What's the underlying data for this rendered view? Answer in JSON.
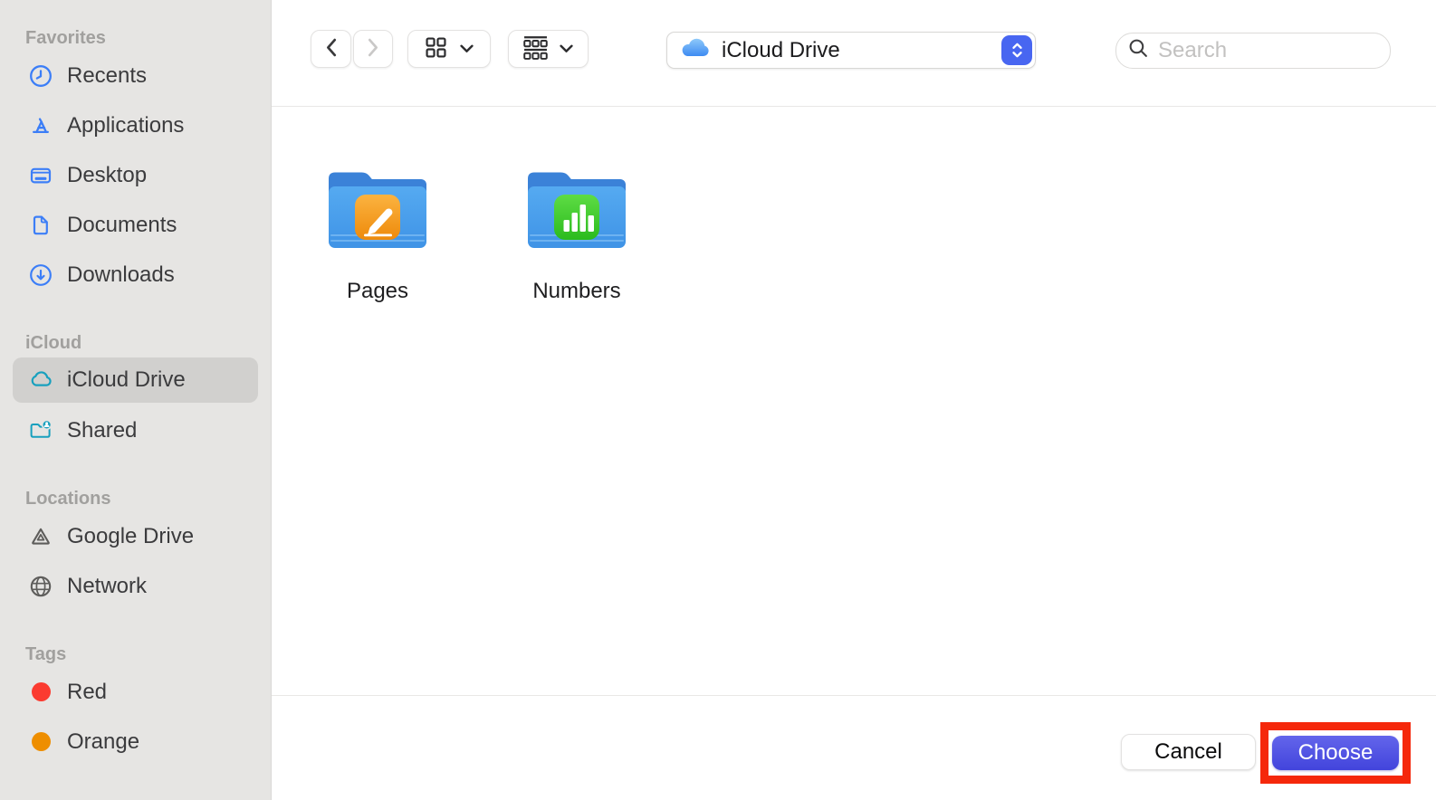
{
  "sidebar": {
    "sections": [
      {
        "title": "Favorites"
      },
      {
        "title": "iCloud"
      },
      {
        "title": "Locations"
      },
      {
        "title": "Tags"
      }
    ],
    "favorites": [
      {
        "label": "Recents",
        "icon": "clock-icon"
      },
      {
        "label": "Applications",
        "icon": "app-store-icon"
      },
      {
        "label": "Desktop",
        "icon": "desktop-icon"
      },
      {
        "label": "Documents",
        "icon": "document-icon"
      },
      {
        "label": "Downloads",
        "icon": "download-circle-icon"
      }
    ],
    "icloud": [
      {
        "label": "iCloud Drive",
        "icon": "icloud-cloud-icon",
        "selected": true
      },
      {
        "label": "Shared",
        "icon": "shared-folder-icon",
        "selected": false
      }
    ],
    "locations": [
      {
        "label": "Google Drive",
        "icon": "google-drive-icon"
      },
      {
        "label": "Network",
        "icon": "network-globe-icon"
      }
    ],
    "tags": [
      {
        "label": "Red",
        "color": "#FB3B30"
      },
      {
        "label": "Orange",
        "color": "#EE8E00"
      }
    ]
  },
  "toolbar": {
    "location_label": "iCloud Drive",
    "search_placeholder": "Search",
    "back_enabled": true,
    "forward_enabled": false
  },
  "files": [
    {
      "name": "Pages",
      "type": "folder",
      "badge": "pages-app"
    },
    {
      "name": "Numbers",
      "type": "folder",
      "badge": "numbers-app"
    }
  ],
  "footer": {
    "cancel_label": "Cancel",
    "choose_label": "Choose"
  },
  "colors": {
    "sidebar_bg": "#E6E5E3",
    "selected_row": "#D1D0CE",
    "icon_blue": "#3C7EF7",
    "icon_teal": "#18A0BE",
    "icon_gray": "#5E5D5B",
    "tag_red": "#FB3B30",
    "tag_orange": "#EE8E00",
    "stepper_blue": "#4866F1",
    "choose_button_blue": "#4F51E2",
    "annotation_red": "#F5280B",
    "folder_blue": "#4A9FEA"
  }
}
